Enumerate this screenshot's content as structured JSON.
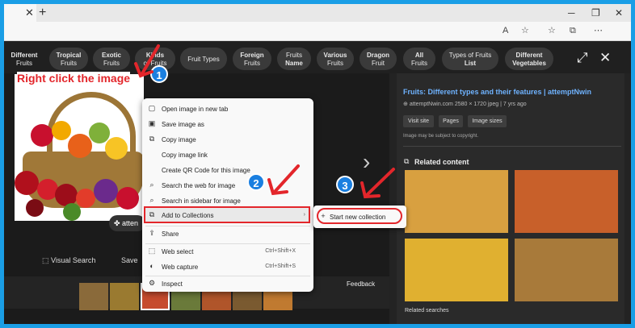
{
  "browser": {
    "tab_close": "✕",
    "new_tab": "+",
    "minimize": "─",
    "maximize": "❐",
    "close": "✕",
    "url_placeholder": ""
  },
  "categories": [
    {
      "line1": "Different",
      "line2": "Fruits"
    },
    {
      "line1": "Tropical",
      "line2": "Fruits"
    },
    {
      "line1": "Exotic",
      "line2": "Fruits"
    },
    {
      "line1": "Kinds",
      "line2": "of Fruits"
    },
    {
      "line1": "Fruit Types",
      "line2": ""
    },
    {
      "line1": "Foreign",
      "line2": "Fruits"
    },
    {
      "line1": "Fruits",
      "line2": "Name"
    },
    {
      "line1": "Various",
      "line2": "Fruits"
    },
    {
      "line1": "Dragon",
      "line2": "Fruit"
    },
    {
      "line1": "All",
      "line2": "Fruits"
    },
    {
      "line1": "Types of Fruits",
      "line2": "List"
    },
    {
      "line1": "Different",
      "line2": "Vegetables"
    }
  ],
  "header_icons": {
    "expand": "⤢",
    "close": "✕"
  },
  "annotation": {
    "instruction": "Right click the image",
    "step1": "1",
    "step2": "2",
    "step3": "3",
    "arrow_color": "#e3262b",
    "step_color": "#1a7fe0"
  },
  "image_overlay": {
    "lens_label": "atten"
  },
  "context_menu": {
    "items": [
      {
        "icon": "▢",
        "label": "Open image in new tab",
        "shortcut": ""
      },
      {
        "icon": "▣",
        "label": "Save image as",
        "shortcut": ""
      },
      {
        "icon": "⧉",
        "label": "Copy image",
        "shortcut": ""
      },
      {
        "icon": "",
        "label": "Copy image link",
        "shortcut": ""
      },
      {
        "icon": "",
        "label": "Create QR Code for this image",
        "shortcut": ""
      },
      {
        "icon": "⌕",
        "label": "Search the web for image",
        "shortcut": ""
      },
      {
        "icon": "⌕",
        "label": "Search in sidebar for image",
        "shortcut": ""
      },
      {
        "icon": "⧉",
        "label": "Add to Collections",
        "shortcut": "›"
      },
      {
        "icon": "⇪",
        "label": "Share",
        "shortcut": ""
      },
      {
        "icon": "⬚",
        "label": "Web select",
        "shortcut": "Ctrl+Shift+X"
      },
      {
        "icon": "◐",
        "label": "Web capture",
        "shortcut": "Ctrl+Shift+S"
      },
      {
        "icon": "⚙",
        "label": "Inspect",
        "shortcut": ""
      }
    ]
  },
  "submenu": {
    "icon": "+",
    "label": "Start new collection"
  },
  "bottom_tools": {
    "visual_search": "Visual Search",
    "save": "Save",
    "feedback": "Feedback"
  },
  "right_panel": {
    "title": "Fruits: Different types and their features | attemptNwin",
    "site": "attemptNwin.com",
    "meta": "2580 × 1720 jpeg  |  7 yrs ago",
    "buttons": [
      "Visit site",
      "Pages",
      "Image sizes"
    ],
    "copyright": "Image may be subject to copyright.",
    "related_heading": "Related content",
    "related_searches": "Related searches"
  },
  "colors": {
    "background_border": "#1a9ee6",
    "dark_bg": "#1b1b1b",
    "link_blue": "#6fb3ff"
  }
}
